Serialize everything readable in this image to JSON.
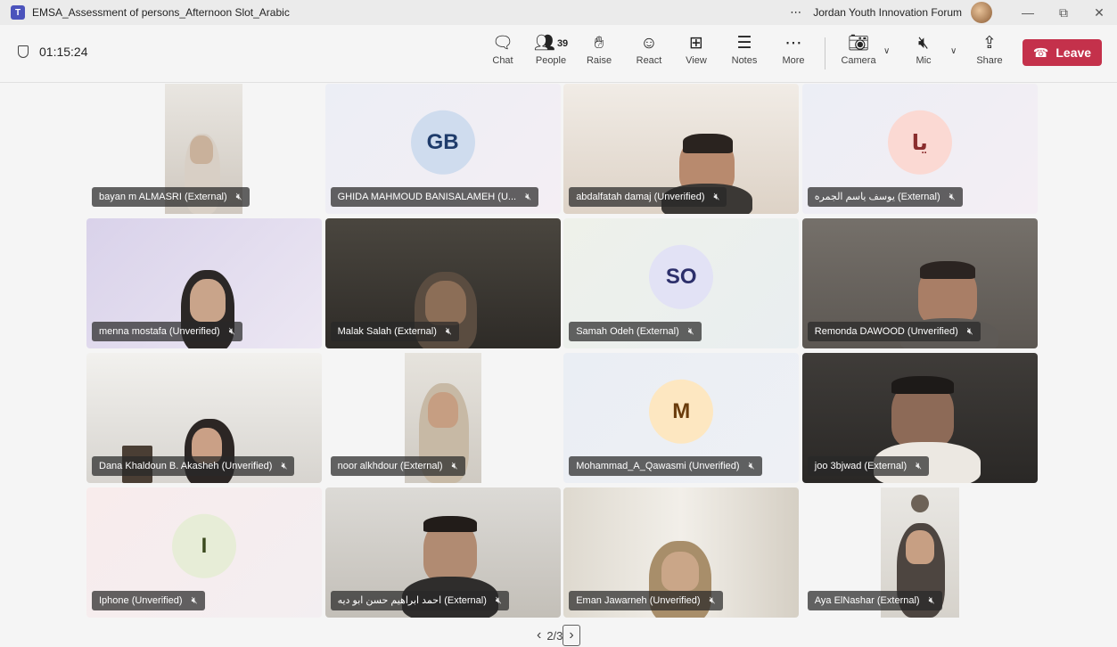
{
  "window": {
    "title": "EMSA_Assessment of persons_Afternoon Slot_Arabic",
    "more": "⋯",
    "org": "Jordan Youth Innovation Forum",
    "minimize": "—",
    "restore": "⧉",
    "close": "✕"
  },
  "toolbar": {
    "timer": "01:15:24",
    "chat": "Chat",
    "people": "People",
    "people_count": "39",
    "raise": "Raise",
    "react": "React",
    "view": "View",
    "notes": "Notes",
    "more": "More",
    "camera": "Camera",
    "mic": "Mic",
    "share": "Share",
    "leave": "Leave"
  },
  "icons": {
    "chat": "chat-bubble-icon",
    "people": "people-icon",
    "raise": "hand-icon",
    "react": "smiley-icon",
    "view": "grid-icon",
    "notes": "notes-icon",
    "more": "ellipsis-icon",
    "camera": "camera-off-icon",
    "mic": "mic-off-icon",
    "share": "share-icon",
    "leave": "phone-hangup-icon"
  },
  "participants": [
    {
      "name": "bayan m ALMASRI (External)"
    },
    {
      "name": "GHIDA MAHMOUD BANISALAMEH (U...",
      "initials": "GB"
    },
    {
      "name": "abdalfatah damaj (Unverified)"
    },
    {
      "name": "يوسف ياسم الجمره (External)",
      "initials": "يا"
    },
    {
      "name": "menna mostafa (Unverified)"
    },
    {
      "name": "Malak Salah (External)"
    },
    {
      "name": "Samah Odeh (External)",
      "initials": "SO"
    },
    {
      "name": "Remonda DAWOOD (Unverified)"
    },
    {
      "name": "Dana Khaldoun B. Akasheh (Unverified)"
    },
    {
      "name": "noor alkhdour (External)"
    },
    {
      "name": "Mohammad_A_Qawasmi (Unverified)",
      "initials": "M"
    },
    {
      "name": "joo 3bjwad (External)"
    },
    {
      "name": "Iphone (Unverified)",
      "initials": "I"
    },
    {
      "name": "احمد ابراهيم حسن ابو ديه (External)"
    },
    {
      "name": "Eman Jawarneh (Unverified)"
    },
    {
      "name": "Aya ElNashar (External)"
    }
  ],
  "pager": {
    "page": "2/3",
    "prev": "‹",
    "next": "›"
  },
  "colors": {
    "leave": "#c4314b",
    "avatar_gb": "#cfdcee",
    "avatar_ya": "#fbd9d3",
    "avatar_so": "#e2e2f5",
    "avatar_m": "#fde7c1",
    "avatar_i": "#e7edd7"
  }
}
